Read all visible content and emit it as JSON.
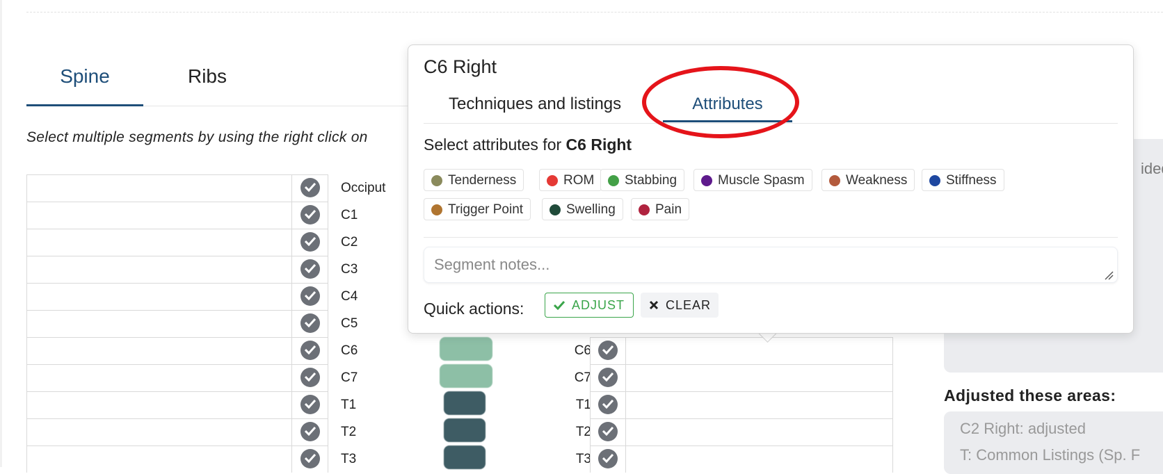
{
  "tabs": {
    "spine": "Spine",
    "ribs": "Ribs"
  },
  "instructions": "Select multiple segments by using the right click on",
  "segments_left": [
    "Occiput",
    "C1",
    "C2",
    "C3",
    "C4",
    "C5",
    "C6",
    "C7",
    "T1",
    "T2",
    "T3"
  ],
  "segments_right": [
    "C6",
    "C7",
    "T1",
    "T2",
    "T3"
  ],
  "popover": {
    "title": "C6 Right",
    "tabs": {
      "techniques": "Techniques and listings",
      "attributes": "Attributes"
    },
    "select_prefix": "Select attributes for ",
    "select_target": "C6 Right",
    "attributes": [
      {
        "label": "Tenderness",
        "color": "#8a8a5c"
      },
      {
        "label": "ROM",
        "color": "#e53935"
      },
      {
        "label": "Stabbing",
        "color": "#43a047"
      },
      {
        "label": "Muscle Spasm",
        "color": "#5e1a8c"
      },
      {
        "label": "Weakness",
        "color": "#b35a3c"
      },
      {
        "label": "Stiffness",
        "color": "#1e47a0"
      },
      {
        "label": "Trigger Point",
        "color": "#b07530"
      },
      {
        "label": "Swelling",
        "color": "#204b3a"
      },
      {
        "label": "Pain",
        "color": "#b0233f"
      }
    ],
    "notes_placeholder": "Segment notes...",
    "quick_actions_label": "Quick actions:",
    "adjust_label": "ADJUST",
    "clear_label": "CLEAR"
  },
  "side": {
    "clipped_text": "ided",
    "adjusted_heading": "Adjusted these areas:",
    "adjusted_items": [
      "C2 Right: adjusted",
      "T: Common Listings (Sp. F"
    ]
  },
  "colors": {
    "accent": "#1e4e79",
    "cervical": "#8dbfa6",
    "thoracic": "#3e5c64",
    "highlight": "#e5141a"
  }
}
